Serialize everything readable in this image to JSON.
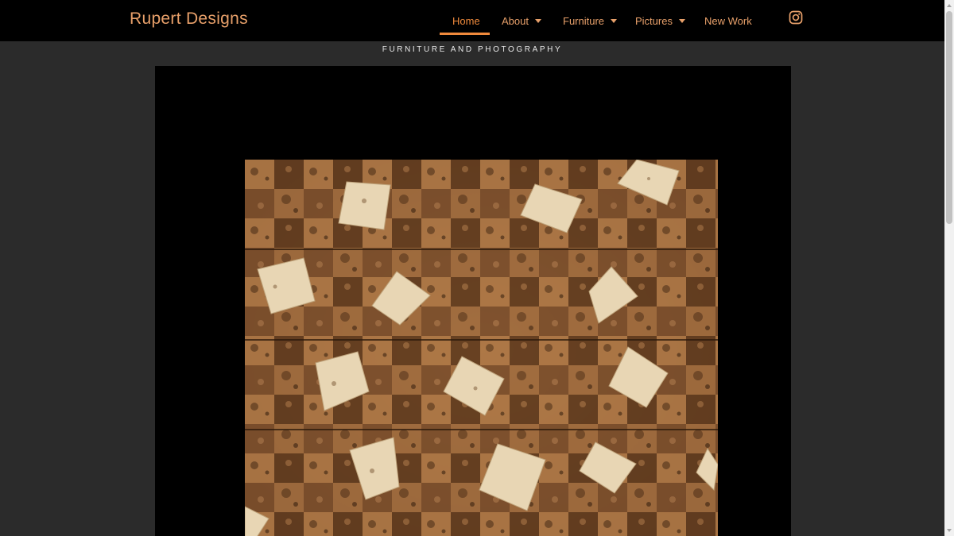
{
  "header": {
    "brand": "Rupert Designs",
    "nav": [
      {
        "label": "Home",
        "active": true,
        "dropdown": false
      },
      {
        "label": "About",
        "active": false,
        "dropdown": true
      },
      {
        "label": "Furniture",
        "active": false,
        "dropdown": true
      },
      {
        "label": "Pictures",
        "active": false,
        "dropdown": true
      },
      {
        "label": "New Work",
        "active": false,
        "dropdown": false
      }
    ],
    "social_icon": "instagram-icon"
  },
  "tagline": "FURNITURE AND PHOTOGRAPHY",
  "hero": {
    "image_subject": "burl wood veneer checkerboard panel with pale wooden blocks"
  },
  "colors": {
    "accent": "#f08a3c",
    "brand": "#e8a06a",
    "header_bg": "#000000",
    "page_bg": "#2b2b2b"
  }
}
